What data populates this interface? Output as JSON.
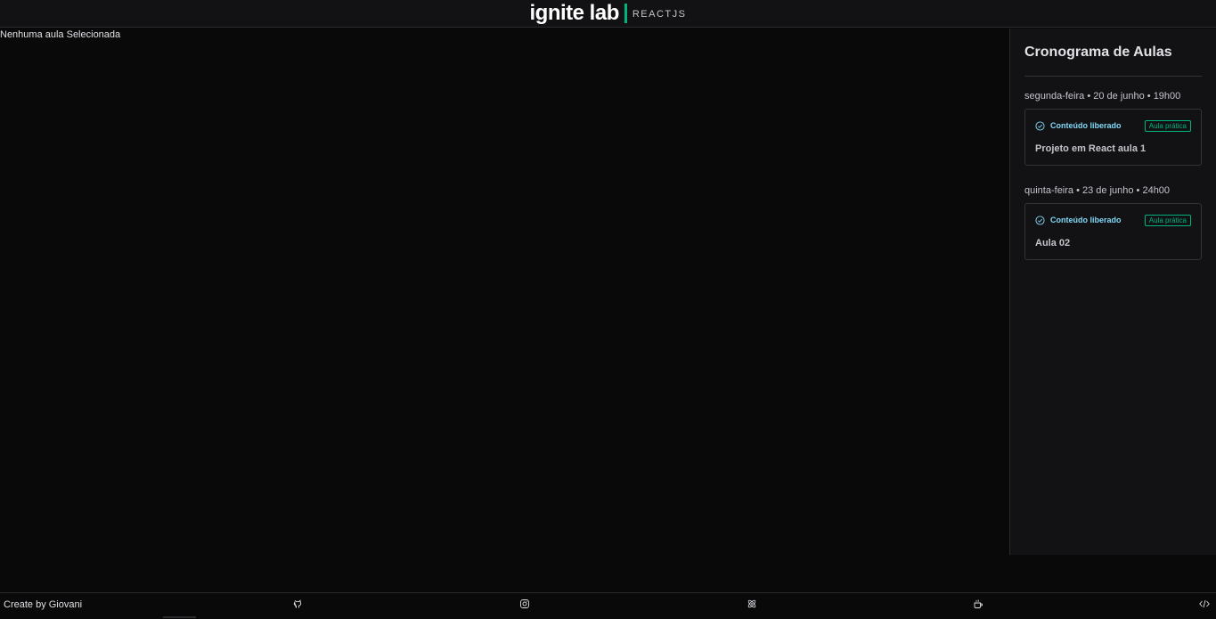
{
  "header": {
    "logo_main": "ignite lab",
    "logo_sub": "REACTJS"
  },
  "main": {
    "empty_message": "Nenhuma aula Selecionada"
  },
  "sidebar": {
    "title": "Cronograma de Aulas",
    "lessons": [
      {
        "date": "segunda-feira • 20 de junho • 19h00",
        "status": "Conteúdo liberado",
        "badge": "Aula prática",
        "title": "Projeto em React aula 1"
      },
      {
        "date": "quinta-feira • 23 de junho • 24h00",
        "status": "Conteúdo liberado",
        "badge": "Aula prática",
        "title": "Aula 02"
      }
    ]
  },
  "footer": {
    "credit": "Create by Giovani",
    "icons": [
      "github-icon",
      "instagram-icon",
      "react-icon",
      "coffee-icon",
      "code-icon"
    ]
  },
  "colors": {
    "background": "#09090a",
    "panel": "#121214",
    "border": "#323238",
    "accent_green": "#00b37e",
    "accent_blue": "#81d8f7"
  }
}
